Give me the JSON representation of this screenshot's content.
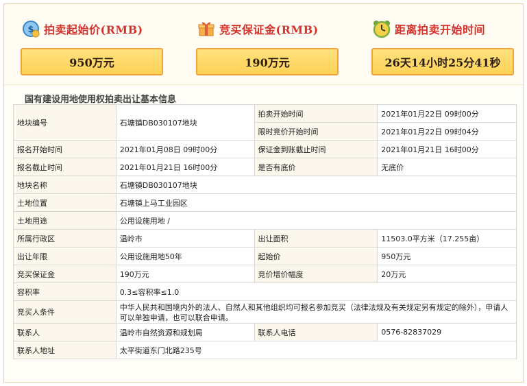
{
  "header": {
    "start_price_label": "拍卖起始价(RMB)",
    "start_price_value": "950万元",
    "deposit_label": "竞买保证金(RMB)",
    "deposit_value": "190万元",
    "countdown_label": "距离拍卖开始时间",
    "countdown_value": "26天14小时25分41秒"
  },
  "icons": {
    "start_price": "money-coin-icon",
    "deposit": "gift-box-icon",
    "countdown": "alarm-clock-icon"
  },
  "colors": {
    "accent_red": "#d4322c",
    "box_fill": "#fdd257",
    "box_border": "#efa33a"
  },
  "section_title": "国有建设用地使用权拍卖出让基本信息",
  "table": {
    "parcel_no_label": "地块编号",
    "parcel_no": "石塘镇DB030107地块",
    "auction_start_label": "拍卖开始时间",
    "auction_start": "2021年01月22日 09时00分",
    "bid_start_label": "限时竞价开始时间",
    "bid_start": "2021年01月22日 09时04分",
    "reg_start_label": "报名开始时间",
    "reg_start": "2021年01月08日 09时00分",
    "deposit_deadline_label": "保证金到账截止时间",
    "deposit_deadline": "2021年01月21日 16时00分",
    "reg_end_label": "报名截止时间",
    "reg_end": "2021年01月21日 16时00分",
    "reserve_label": "是否有底价",
    "reserve": "无底价",
    "parcel_name_label": "地块名称",
    "parcel_name": "石塘镇DB030107地块",
    "location_label": "土地位置",
    "location": "石塘镇上马工业园区",
    "usage_label": "土地用途",
    "usage": "公用设施用地 /",
    "district_label": "所属行政区",
    "district": "温岭市",
    "area_label": "出让面积",
    "area": "11503.0平方米（17.255亩）",
    "term_label": "出让年限",
    "term": "公用设施用地50年",
    "start_price_label": "起始价",
    "start_price": "950万元",
    "deposit_label": "竞买保证金",
    "deposit": "190万元",
    "increment_label": "竞价增价幅度",
    "increment": "20万元",
    "far_label": "容积率",
    "far": "0.3≤容积率≤1.0",
    "bidder_label": "竞买人条件",
    "bidder": "中华人民共和国境内外的法人、自然人和其他组织均可报名参加竞买（法律法规及有关规定另有规定的除外），申请人可以单独申请，也可以联合申请。",
    "contact_label": "联系人",
    "contact": "温岭市自然资源和规划局",
    "phone_label": "联系人电话",
    "phone": "0576-82837029",
    "address_label": "联系人地址",
    "address": "太平街道东门北路235号"
  }
}
